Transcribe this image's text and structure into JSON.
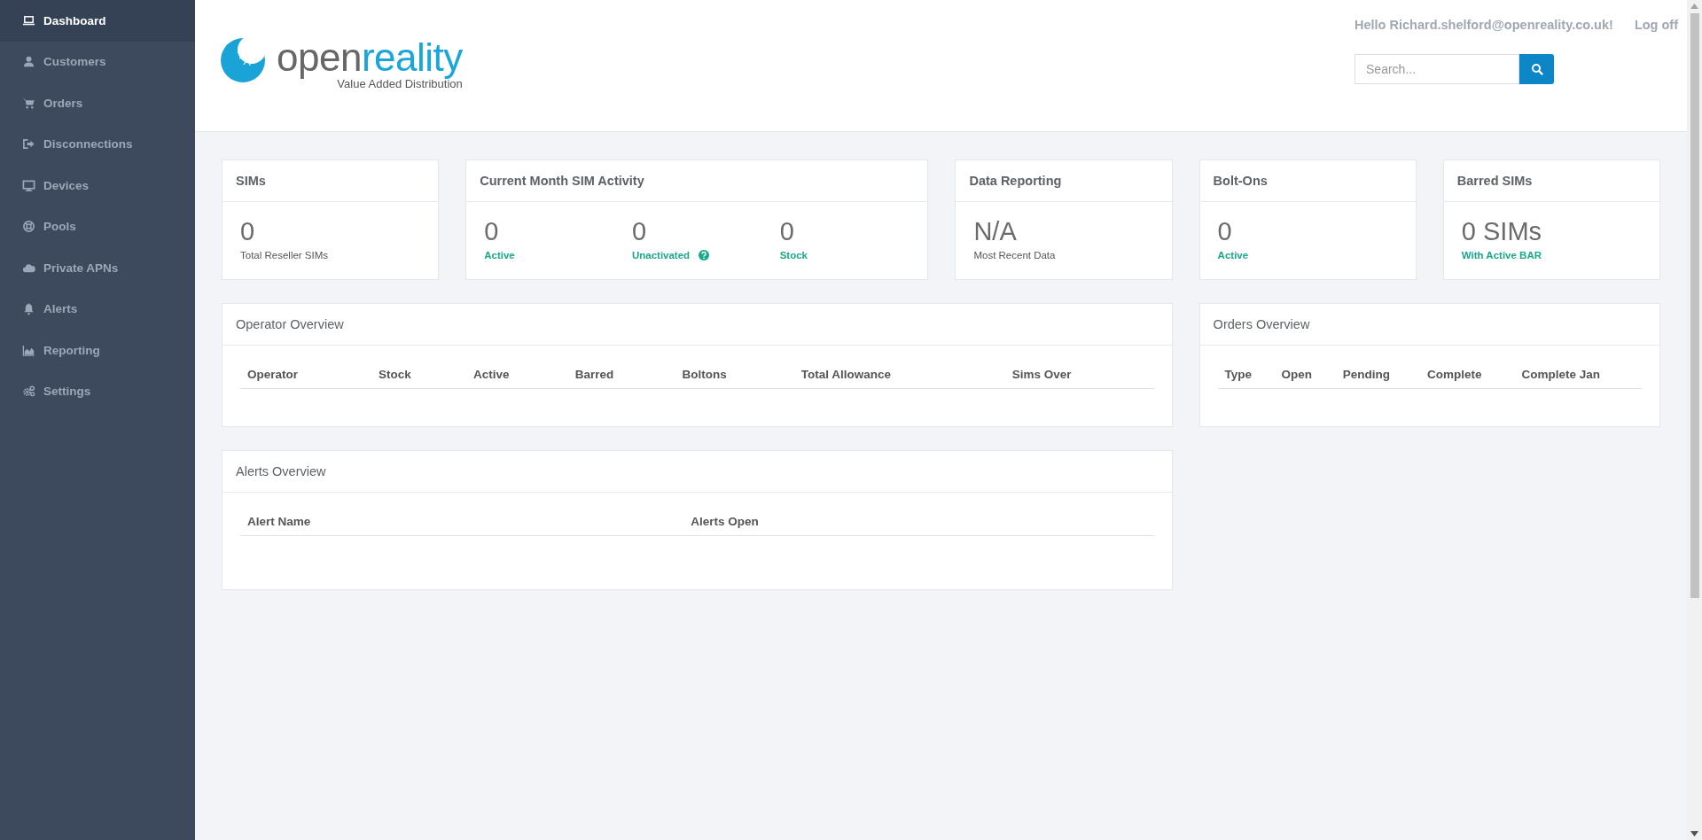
{
  "sidebar": {
    "items": [
      {
        "label": "Dashboard",
        "selected": true
      },
      {
        "label": "Customers",
        "selected": false
      },
      {
        "label": "Orders",
        "selected": false
      },
      {
        "label": "Disconnections",
        "selected": false
      },
      {
        "label": "Devices",
        "selected": false
      },
      {
        "label": "Pools",
        "selected": false
      },
      {
        "label": "Private APNs",
        "selected": false
      },
      {
        "label": "Alerts",
        "selected": false
      },
      {
        "label": "Reporting",
        "selected": false
      },
      {
        "label": "Settings",
        "selected": false
      }
    ]
  },
  "header": {
    "logo": {
      "word_first": "open",
      "word_second": "reality",
      "tagline": "Value Added Distribution"
    },
    "greeting": "Hello Richard.shelford@openreality.co.uk!",
    "logoff": "Log off",
    "search": {
      "placeholder": "Search..."
    }
  },
  "stats": [
    {
      "title": "SIMs",
      "metrics": [
        {
          "value": "0",
          "label": "Total Reseller SIMs",
          "kind": "caption",
          "help": false
        }
      ]
    },
    {
      "title": "Current Month SIM Activity",
      "metrics": [
        {
          "value": "0",
          "label": "Active",
          "kind": "status",
          "help": false
        },
        {
          "value": "0",
          "label": "Unactivated",
          "kind": "status",
          "help": true
        },
        {
          "value": "0",
          "label": "Stock",
          "kind": "status",
          "help": false
        }
      ]
    },
    {
      "title": "Data Reporting",
      "metrics": [
        {
          "value": "N/A",
          "label": "Most Recent Data",
          "kind": "caption",
          "help": false
        }
      ]
    },
    {
      "title": "Bolt-Ons",
      "metrics": [
        {
          "value": "0",
          "label": "Active",
          "kind": "status",
          "help": false
        }
      ]
    },
    {
      "title": "Barred SIMs",
      "metrics": [
        {
          "value": "0 SIMs",
          "label": "With Active BAR",
          "kind": "status",
          "help": false
        }
      ]
    }
  ],
  "tables": [
    {
      "title": "Operator Overview",
      "columns": [
        "Operator",
        "Stock",
        "Active",
        "Barred",
        "Boltons",
        "Total Allowance",
        "Sims Over"
      ]
    },
    {
      "title": "Orders Overview",
      "columns": [
        "Type",
        "Open",
        "Pending",
        "Complete",
        "Complete Jan"
      ]
    },
    {
      "title": "Alerts Overview",
      "columns": [
        "Alert Name",
        "Alerts Open"
      ]
    }
  ]
}
